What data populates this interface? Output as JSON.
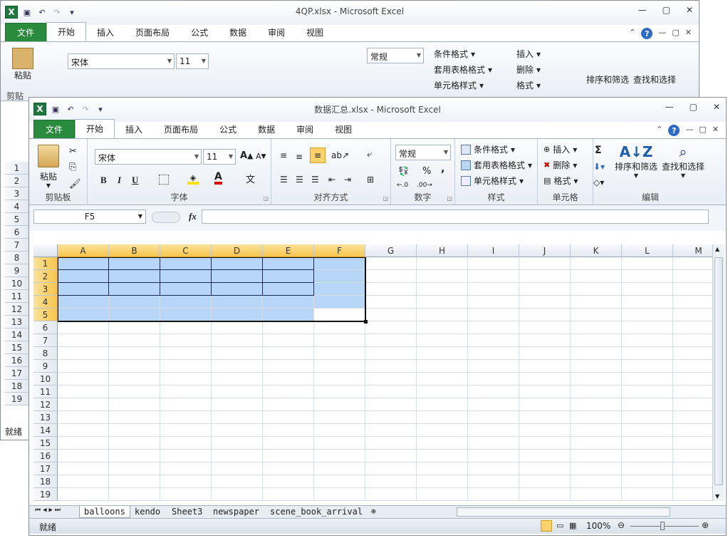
{
  "back_window": {
    "title": "4QP.xlsx  -  Microsoft Excel",
    "tabs": [
      "文件",
      "开始",
      "插入",
      "页面布局",
      "公式",
      "数据",
      "审阅",
      "视图"
    ],
    "font_name": "宋体",
    "font_size": "11",
    "number_format": "常规",
    "paste": "粘贴",
    "clipboard_group": "剪贴",
    "styles": [
      "条件格式",
      "套用表格格式",
      "单元格样式"
    ],
    "cells": [
      "插入",
      "删除",
      "格式"
    ],
    "sort": "排序和筛选",
    "find": "查找和选择",
    "rows": [
      "1",
      "2",
      "3",
      "4",
      "5",
      "6",
      "7",
      "8",
      "9",
      "10",
      "11",
      "12",
      "13",
      "14",
      "15",
      "16",
      "17",
      "18",
      "19"
    ],
    "status": "就绪"
  },
  "front_window": {
    "title": "数据汇总.xlsx  -  Microsoft Excel",
    "tabs": [
      "文件",
      "开始",
      "插入",
      "页面布局",
      "公式",
      "数据",
      "审阅",
      "视图"
    ],
    "ribbon": {
      "paste": "粘贴",
      "font_name": "宋体",
      "font_size": "11",
      "bold": "B",
      "italic": "I",
      "underline": "U",
      "number_format": "常规",
      "percent": "%",
      "comma": ",",
      "styles": [
        "条件格式",
        "套用表格格式",
        "单元格样式"
      ],
      "cells": [
        "插入",
        "删除",
        "格式"
      ],
      "sigma": "Σ",
      "sort": "排序和筛选",
      "find": "查找和选择",
      "groups": [
        "剪贴板",
        "字体",
        "对齐方式",
        "数字",
        "样式",
        "单元格",
        "编辑"
      ]
    },
    "namebox": "F5",
    "fx": "fx",
    "columns": [
      "A",
      "B",
      "C",
      "D",
      "E",
      "F",
      "G",
      "H",
      "I",
      "J",
      "K",
      "L",
      "M"
    ],
    "rows": [
      "1",
      "2",
      "3",
      "4",
      "5",
      "6",
      "7",
      "8",
      "9",
      "10",
      "11",
      "12",
      "13",
      "14",
      "15",
      "16",
      "17",
      "18",
      "19"
    ],
    "sheets": [
      "balloons",
      "kendo",
      "Sheet3",
      "newspaper",
      "scene_book_arrival"
    ],
    "status": "就绪",
    "zoom": "100%"
  },
  "colors": {
    "file_tab": "#2a8a3e",
    "selection": "#b8d6f7",
    "header_sel": "#f7c54d"
  }
}
